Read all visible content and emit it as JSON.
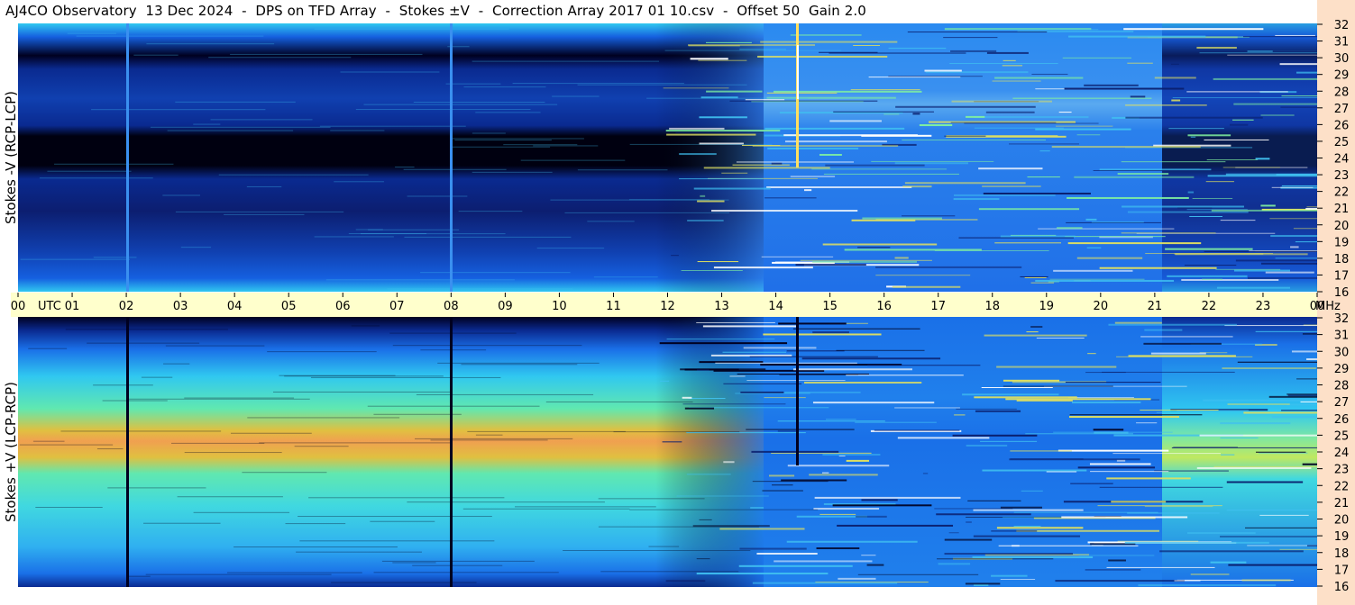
{
  "title": "AJ4CO Observatory  13 Dec 2024  -  DPS on TFD Array  -  Stokes ±V  -  Correction Array 2017 01 10.csv  -  Offset 50  Gain 2.0",
  "colors": {
    "background": "#ffffff",
    "time_band": "#ffffcc",
    "freq_band": "#fde0c8",
    "dark": "#000020",
    "navy": "#0a1f6e",
    "blue": "#1560e0",
    "cyan": "#30c8f0",
    "green": "#80e080",
    "orange": "#f0a050"
  },
  "chart_data": [
    {
      "type": "heatmap",
      "title": "AJ4CO Observatory  13 Dec 2024  -  DPS on TFD Array  -  Stokes ±V  -  Correction Array 2017 01 10.csv  -  Offset 50  Gain 2.0",
      "ylabel": "Stokes -V (RCP-LCP)",
      "xlabel": "UTC",
      "x_ticks": [
        "00",
        "UTC",
        "01",
        "02",
        "03",
        "04",
        "05",
        "06",
        "07",
        "08",
        "09",
        "10",
        "11",
        "12",
        "13",
        "14",
        "15",
        "16",
        "17",
        "18",
        "19",
        "20",
        "21",
        "22",
        "23",
        "00",
        "MHz"
      ],
      "x_range": [
        0,
        24
      ],
      "y_ticks": [
        32,
        31,
        30,
        29,
        28,
        27,
        26,
        25,
        24,
        23,
        22,
        21,
        20,
        19,
        18,
        17,
        16
      ],
      "y_range": [
        16,
        32
      ],
      "y_unit": "MHz"
    },
    {
      "type": "heatmap",
      "title": "",
      "ylabel": "Stokes +V (LCP-RCP)",
      "xlabel": "UTC",
      "x_range": [
        0,
        24
      ],
      "y_ticks": [
        32,
        31,
        30,
        29,
        28,
        27,
        26,
        25,
        24,
        23,
        22,
        21,
        20,
        19,
        18,
        17,
        16
      ],
      "y_range": [
        16,
        32
      ],
      "y_unit": "MHz"
    }
  ]
}
